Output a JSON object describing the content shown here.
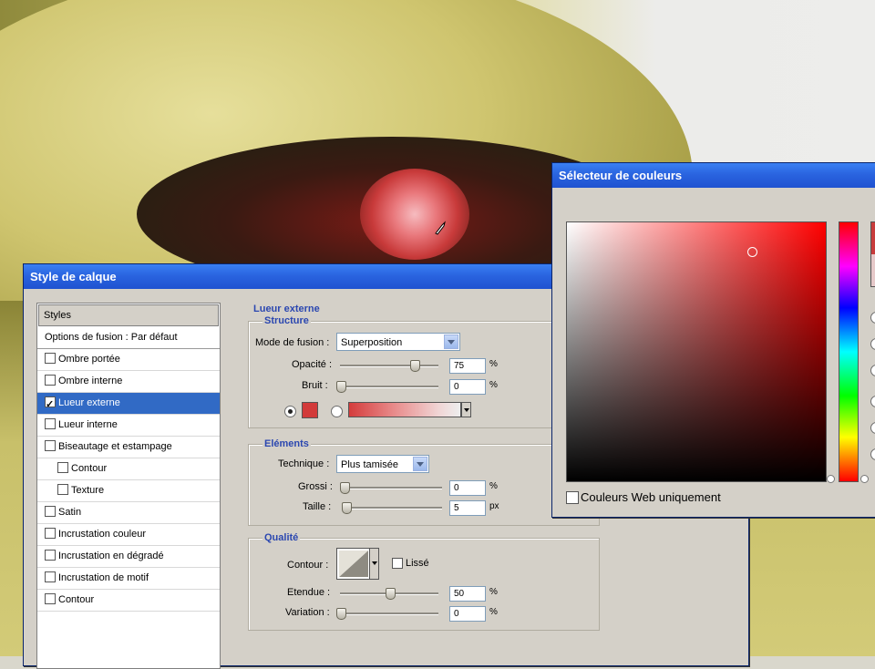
{
  "layer_style": {
    "title": "Style de calque",
    "styles_list": {
      "header": "Styles",
      "blend_options": "Options de fusion : Par défaut",
      "items": [
        {
          "label": "Ombre portée",
          "checked": false,
          "indent": false
        },
        {
          "label": "Ombre interne",
          "checked": false,
          "indent": false
        },
        {
          "label": "Lueur externe",
          "checked": true,
          "indent": false,
          "selected": true
        },
        {
          "label": "Lueur interne",
          "checked": false,
          "indent": false
        },
        {
          "label": "Biseautage et estampage",
          "checked": false,
          "indent": false
        },
        {
          "label": "Contour",
          "checked": false,
          "indent": true
        },
        {
          "label": "Texture",
          "checked": false,
          "indent": true
        },
        {
          "label": "Satin",
          "checked": false,
          "indent": false
        },
        {
          "label": "Incrustation couleur",
          "checked": false,
          "indent": false
        },
        {
          "label": "Incrustation en dégradé",
          "checked": false,
          "indent": false
        },
        {
          "label": "Incrustation de motif",
          "checked": false,
          "indent": false
        },
        {
          "label": "Contour",
          "checked": false,
          "indent": false
        }
      ]
    },
    "outer_glow": {
      "section_title": "Lueur externe",
      "structure": {
        "title": "Structure",
        "blend_mode_label": "Mode de fusion :",
        "blend_mode_value": "Superposition",
        "opacity_label": "Opacité :",
        "opacity_value": "75",
        "opacity_level": 0.75,
        "noise_label": "Bruit :",
        "noise_value": "0",
        "noise_level": 0.0,
        "percent": "%",
        "color": "#d23a3a"
      },
      "elements": {
        "title": "Eléments",
        "technique_label": "Technique :",
        "technique_value": "Plus tamisée",
        "spread_label": "Grossi :",
        "spread_value": "0",
        "spread_level": 0.0,
        "size_label": "Taille :",
        "size_value": "5",
        "size_level": 0.02,
        "percent": "%",
        "px": "px"
      },
      "quality": {
        "title": "Qualité",
        "contour_label": "Contour :",
        "antialias_label": "Lissé",
        "range_label": "Etendue :",
        "range_value": "50",
        "range_level": 0.5,
        "jitter_label": "Variation :",
        "jitter_value": "0",
        "jitter_level": 0.0,
        "percent": "%"
      }
    }
  },
  "color_picker": {
    "title": "Sélecteur de couleurs",
    "web_colors_label": "Couleurs Web uniquement",
    "new_color": "#c83c3c",
    "old_color": "#e6c9c9"
  }
}
